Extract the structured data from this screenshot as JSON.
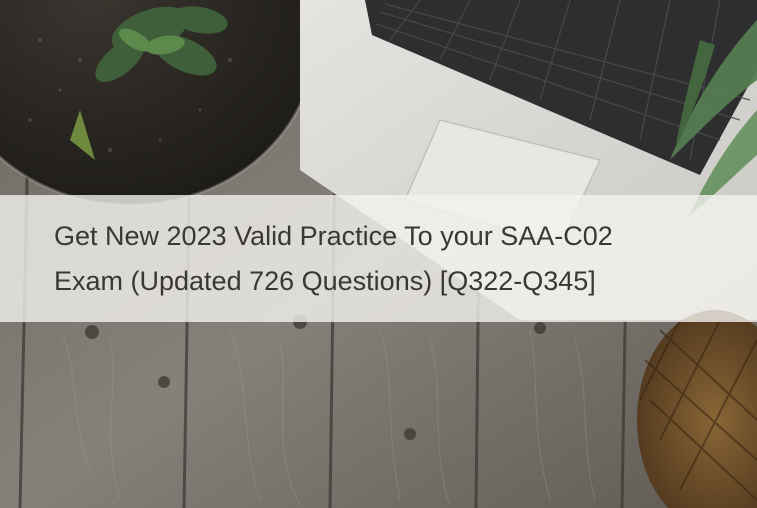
{
  "banner": {
    "title_line_1": "Get New 2023 Valid Practice To your SAA-C02",
    "title_line_2": "Exam (Updated 726 Questions) [Q322-Q345]"
  },
  "scene": {
    "objects": [
      "glass-terrarium-with-succulents",
      "laptop-keyboard",
      "trackpad",
      "palm-leaves",
      "pineapple",
      "weathered-wood-planks"
    ],
    "colors": {
      "wood": "#7d776e",
      "laptop": "#d9d7d4",
      "keys": "#2e2e30",
      "plant": "#3f5f3a",
      "soil": "#2a2723",
      "pineapple": "#6a4a2a",
      "band": "#f4f2ee",
      "text": "#3a3836"
    }
  }
}
